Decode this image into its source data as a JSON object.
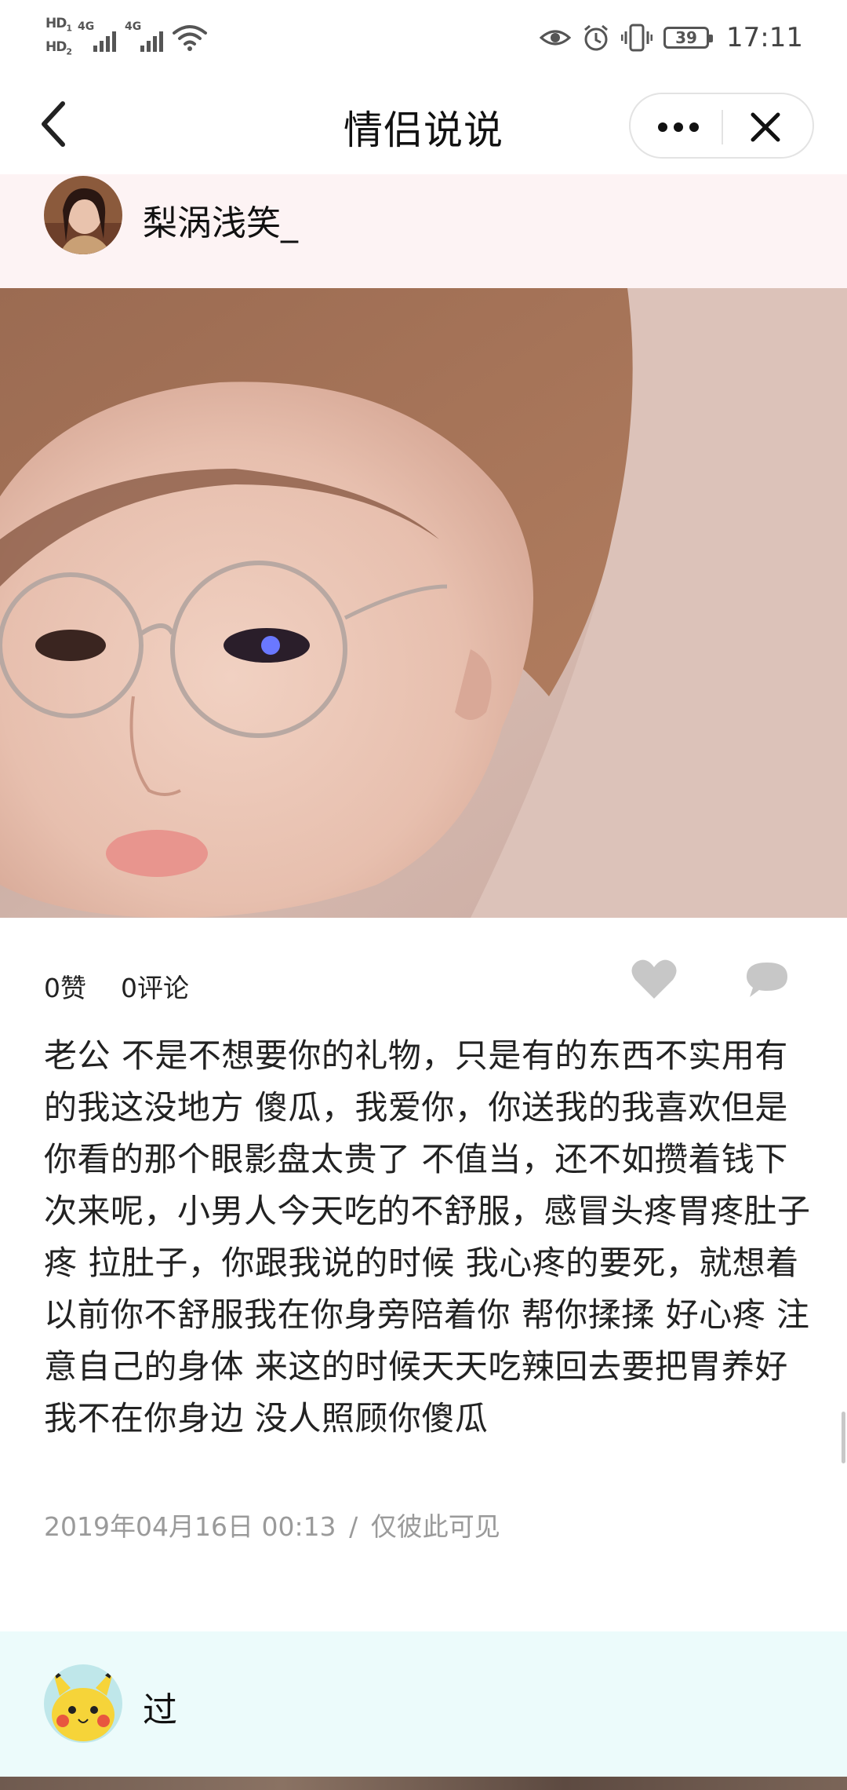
{
  "status_bar": {
    "hd1": "HD",
    "hd1_sub": "1",
    "hd2": "HD",
    "hd2_sub": "2",
    "net1": "4G",
    "net2": "4G",
    "battery": "39",
    "time": "17:11",
    "icons": [
      "eye-icon",
      "alarm-icon",
      "vibrate-icon",
      "battery-icon"
    ]
  },
  "nav": {
    "title": "情侣说说",
    "back_icon": "chevron-left-icon",
    "more_icon": "more-dots-icon",
    "close_icon": "close-icon"
  },
  "post1": {
    "username": "梨涡浅笑_",
    "likes": "0赞",
    "comments": "0评论",
    "text": "老公 不是不想要你的礼物，只是有的东西不实用有的我这没地方 傻瓜，我爱你，你送我的我喜欢但是你看的那个眼影盘太贵了 不值当，还不如攒着钱下次来呢，小男人今天吃的不舒服，感冒头疼胃疼肚子疼 拉肚子，你跟我说的时候 我心疼的要死，就想着以前你不舒服我在你身旁陪着你 帮你揉揉 好心疼 注意自己的身体 来这的时候天天吃辣回去要把胃养好 我不在你身边 没人照顾你傻瓜",
    "date": "2019年04月16日 00:13",
    "separator": "/",
    "visibility": "仅彼此可见",
    "head_bg": "#fdf3f4"
  },
  "post2": {
    "username": "过",
    "head_bg": "#ecfbfb"
  }
}
